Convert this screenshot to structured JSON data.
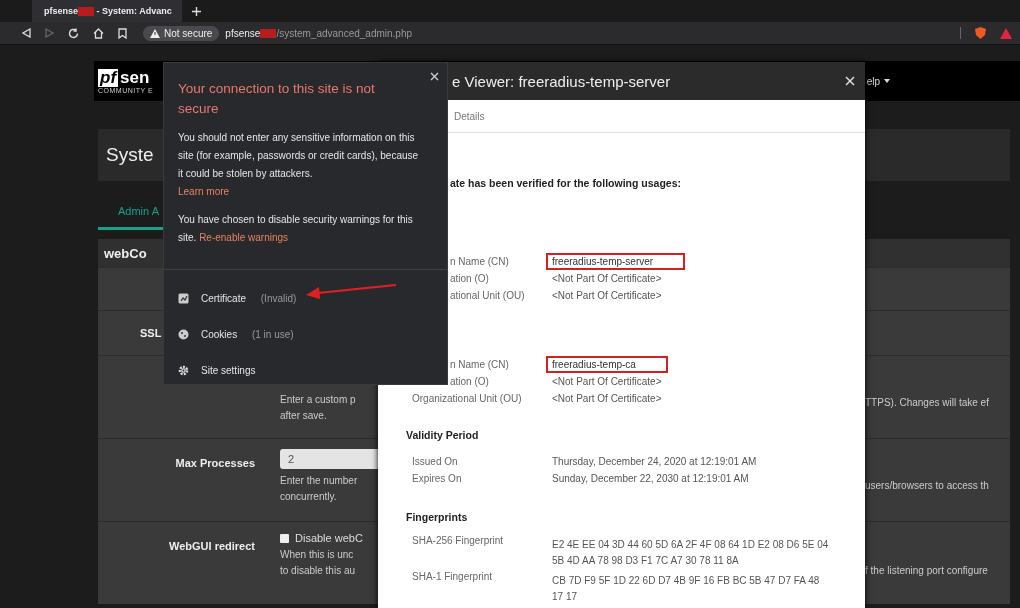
{
  "browser": {
    "tab": {
      "title_start": "pfsense",
      "title_end": " - System: Advanc",
      "redacted": true
    },
    "address_bar": {
      "security_chip": "Not secure",
      "url_host": "pfsense",
      "url_path": "/system_advanced_admin.php",
      "redacted": true
    }
  },
  "page": {
    "navbar": {
      "logo_mark": "pf",
      "logo_text": "sen",
      "logo_subtitle": "COMMUNITY E",
      "menu_item": "elp"
    },
    "header": "Syste",
    "tab": {
      "label": "Admin A",
      "selected": true
    },
    "panel": {
      "title": "webCo",
      "rows": [
        {
          "kind": "blank"
        },
        {
          "kind": "label",
          "label": "SSL"
        },
        {
          "kind": "help",
          "help": [
            "Enter a custom p",
            "after save."
          ],
          "help_right": "TTPS). Changes will take ef"
        },
        {
          "kind": "input",
          "label": "Max Processes",
          "value": "2",
          "help": [
            "Enter the number",
            "concurrently."
          ],
          "help_right": "users/browsers to access th"
        },
        {
          "kind": "checkbox",
          "label": "WebGUI redirect",
          "checked": false,
          "checkbox_label": "Disable webC",
          "help": [
            "When this is unc",
            "to disable this au"
          ],
          "help_right": "f the listening port configure"
        }
      ]
    }
  },
  "cert_viewer": {
    "title": "e Viewer: freeradius-temp-server",
    "tabs": [
      {
        "label": "Details",
        "selected": false
      }
    ],
    "usage_text": "ate has been verified for the following usages:",
    "issued_to": [
      {
        "label": "n Name (CN)",
        "value": "freeradius-temp-server",
        "highlighted": true
      },
      {
        "label": "ation (O)",
        "value": "<Not Part Of Certificate>",
        "highlighted": false
      },
      {
        "label": "ational Unit (OU)",
        "value": "<Not Part Of Certificate>",
        "highlighted": false
      }
    ],
    "issued_by": [
      {
        "label": "n Name (CN)",
        "value": "freeradius-temp-ca",
        "highlighted": true
      },
      {
        "label": "ation (O)",
        "value": "<Not Part Of Certificate>",
        "highlighted": false
      },
      {
        "label": "Organizational Unit (OU)",
        "value": "<Not Part Of Certificate>",
        "highlighted": false
      }
    ],
    "validity": {
      "title": "Validity Period",
      "rows": [
        {
          "label": "Issued On",
          "value": "Thursday, December 24, 2020 at 12:19:01 AM"
        },
        {
          "label": "Expires On",
          "value": "Sunday, December 22, 2030 at 12:19:01 AM"
        }
      ]
    },
    "fingerprints": {
      "title": "Fingerprints",
      "rows": [
        {
          "label": "SHA-256 Fingerprint",
          "value": "E2 4E EE 04 3D 44 60 5D 6A 2F 4F 08 64 1D E2 08 D6 5E 04 5B 4D AA 78 98 D3 F1 7C A7 30 78 11 8A"
        },
        {
          "label": "SHA-1 Fingerprint",
          "value": "CB 7D F9 5F 1D 22 6D D7 4B 9F 16 FB BC 5B 47 D7 FA 48 17 17"
        }
      ]
    }
  },
  "site_popup": {
    "title": "Your connection to this site is not secure",
    "paragraphs": [
      {
        "text": "You should not enter any sensitive information on this site (for example, passwords or credit cards), because it could be stolen by attackers.",
        "link": "Learn more",
        "link_on_new_line": true
      },
      {
        "text": "You have chosen to disable security warnings for this site.",
        "link": "Re-enable warnings",
        "link_on_new_line": false
      }
    ],
    "items": [
      {
        "kind": "certificate",
        "label": "Certificate",
        "note": "(Invalid)"
      },
      {
        "kind": "cookies",
        "label": "Cookies",
        "note": "(1 in use)"
      },
      {
        "kind": "settings",
        "label": "Site settings"
      }
    ]
  }
}
